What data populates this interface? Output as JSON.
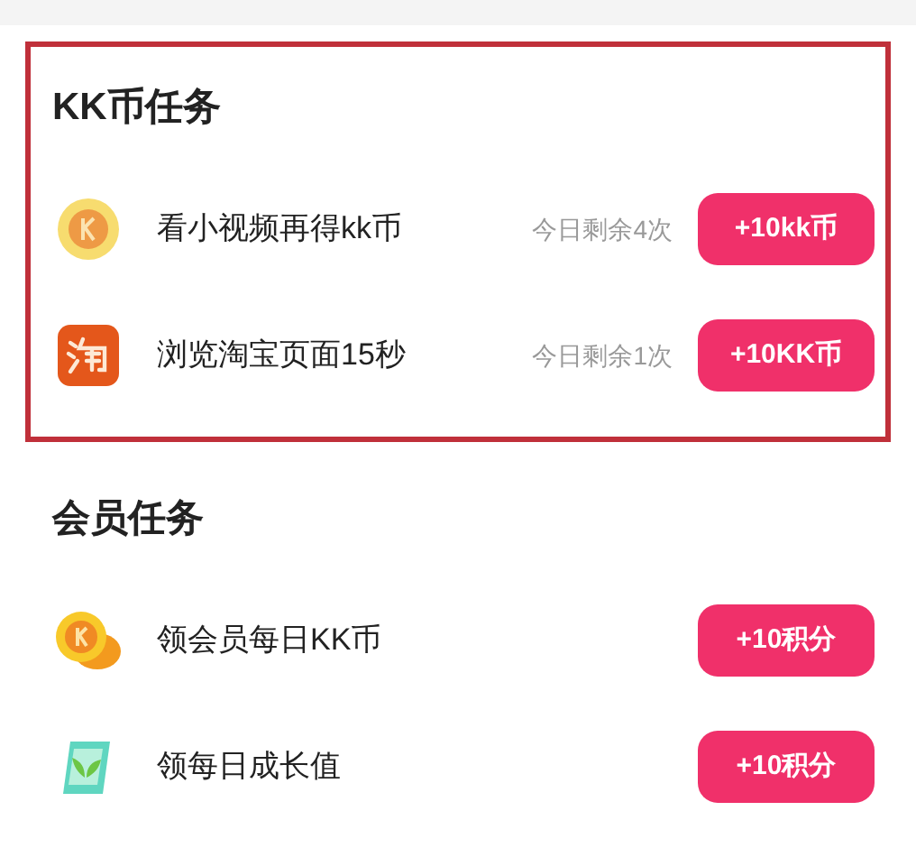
{
  "sections": [
    {
      "title": "KK币任务",
      "highlighted": true,
      "tasks": [
        {
          "kind": "coin",
          "label": "看小视频再得kk币",
          "remaining": "今日剩余4次",
          "reward": "+10kk币"
        },
        {
          "kind": "taobao",
          "label": "浏览淘宝页面15秒",
          "remaining": "今日剩余1次",
          "reward": "+10KK币"
        }
      ]
    },
    {
      "title": "会员任务",
      "highlighted": false,
      "tasks": [
        {
          "kind": "coins",
          "label": "领会员每日KK币",
          "reward": "+10积分"
        },
        {
          "kind": "plant",
          "label": "领每日成长值",
          "reward": "+10积分"
        }
      ]
    }
  ]
}
